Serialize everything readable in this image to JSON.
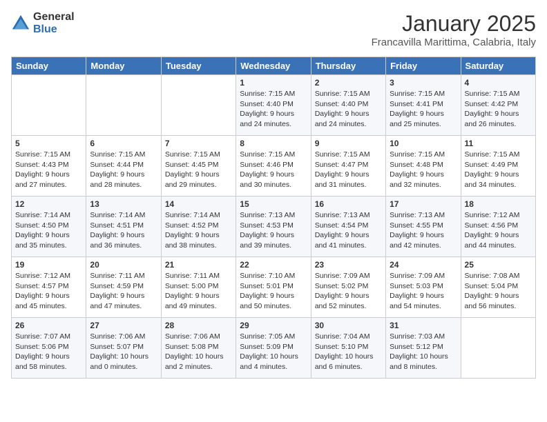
{
  "logo": {
    "general": "General",
    "blue": "Blue"
  },
  "title": "January 2025",
  "subtitle": "Francavilla Marittima, Calabria, Italy",
  "days_of_week": [
    "Sunday",
    "Monday",
    "Tuesday",
    "Wednesday",
    "Thursday",
    "Friday",
    "Saturday"
  ],
  "weeks": [
    [
      {
        "day": "",
        "info": ""
      },
      {
        "day": "",
        "info": ""
      },
      {
        "day": "",
        "info": ""
      },
      {
        "day": "1",
        "info": "Sunrise: 7:15 AM\nSunset: 4:40 PM\nDaylight: 9 hours\nand 24 minutes."
      },
      {
        "day": "2",
        "info": "Sunrise: 7:15 AM\nSunset: 4:40 PM\nDaylight: 9 hours\nand 24 minutes."
      },
      {
        "day": "3",
        "info": "Sunrise: 7:15 AM\nSunset: 4:41 PM\nDaylight: 9 hours\nand 25 minutes."
      },
      {
        "day": "4",
        "info": "Sunrise: 7:15 AM\nSunset: 4:42 PM\nDaylight: 9 hours\nand 26 minutes."
      }
    ],
    [
      {
        "day": "5",
        "info": "Sunrise: 7:15 AM\nSunset: 4:43 PM\nDaylight: 9 hours\nand 27 minutes."
      },
      {
        "day": "6",
        "info": "Sunrise: 7:15 AM\nSunset: 4:44 PM\nDaylight: 9 hours\nand 28 minutes."
      },
      {
        "day": "7",
        "info": "Sunrise: 7:15 AM\nSunset: 4:45 PM\nDaylight: 9 hours\nand 29 minutes."
      },
      {
        "day": "8",
        "info": "Sunrise: 7:15 AM\nSunset: 4:46 PM\nDaylight: 9 hours\nand 30 minutes."
      },
      {
        "day": "9",
        "info": "Sunrise: 7:15 AM\nSunset: 4:47 PM\nDaylight: 9 hours\nand 31 minutes."
      },
      {
        "day": "10",
        "info": "Sunrise: 7:15 AM\nSunset: 4:48 PM\nDaylight: 9 hours\nand 32 minutes."
      },
      {
        "day": "11",
        "info": "Sunrise: 7:15 AM\nSunset: 4:49 PM\nDaylight: 9 hours\nand 34 minutes."
      }
    ],
    [
      {
        "day": "12",
        "info": "Sunrise: 7:14 AM\nSunset: 4:50 PM\nDaylight: 9 hours\nand 35 minutes."
      },
      {
        "day": "13",
        "info": "Sunrise: 7:14 AM\nSunset: 4:51 PM\nDaylight: 9 hours\nand 36 minutes."
      },
      {
        "day": "14",
        "info": "Sunrise: 7:14 AM\nSunset: 4:52 PM\nDaylight: 9 hours\nand 38 minutes."
      },
      {
        "day": "15",
        "info": "Sunrise: 7:13 AM\nSunset: 4:53 PM\nDaylight: 9 hours\nand 39 minutes."
      },
      {
        "day": "16",
        "info": "Sunrise: 7:13 AM\nSunset: 4:54 PM\nDaylight: 9 hours\nand 41 minutes."
      },
      {
        "day": "17",
        "info": "Sunrise: 7:13 AM\nSunset: 4:55 PM\nDaylight: 9 hours\nand 42 minutes."
      },
      {
        "day": "18",
        "info": "Sunrise: 7:12 AM\nSunset: 4:56 PM\nDaylight: 9 hours\nand 44 minutes."
      }
    ],
    [
      {
        "day": "19",
        "info": "Sunrise: 7:12 AM\nSunset: 4:57 PM\nDaylight: 9 hours\nand 45 minutes."
      },
      {
        "day": "20",
        "info": "Sunrise: 7:11 AM\nSunset: 4:59 PM\nDaylight: 9 hours\nand 47 minutes."
      },
      {
        "day": "21",
        "info": "Sunrise: 7:11 AM\nSunset: 5:00 PM\nDaylight: 9 hours\nand 49 minutes."
      },
      {
        "day": "22",
        "info": "Sunrise: 7:10 AM\nSunset: 5:01 PM\nDaylight: 9 hours\nand 50 minutes."
      },
      {
        "day": "23",
        "info": "Sunrise: 7:09 AM\nSunset: 5:02 PM\nDaylight: 9 hours\nand 52 minutes."
      },
      {
        "day": "24",
        "info": "Sunrise: 7:09 AM\nSunset: 5:03 PM\nDaylight: 9 hours\nand 54 minutes."
      },
      {
        "day": "25",
        "info": "Sunrise: 7:08 AM\nSunset: 5:04 PM\nDaylight: 9 hours\nand 56 minutes."
      }
    ],
    [
      {
        "day": "26",
        "info": "Sunrise: 7:07 AM\nSunset: 5:06 PM\nDaylight: 9 hours\nand 58 minutes."
      },
      {
        "day": "27",
        "info": "Sunrise: 7:06 AM\nSunset: 5:07 PM\nDaylight: 10 hours\nand 0 minutes."
      },
      {
        "day": "28",
        "info": "Sunrise: 7:06 AM\nSunset: 5:08 PM\nDaylight: 10 hours\nand 2 minutes."
      },
      {
        "day": "29",
        "info": "Sunrise: 7:05 AM\nSunset: 5:09 PM\nDaylight: 10 hours\nand 4 minutes."
      },
      {
        "day": "30",
        "info": "Sunrise: 7:04 AM\nSunset: 5:10 PM\nDaylight: 10 hours\nand 6 minutes."
      },
      {
        "day": "31",
        "info": "Sunrise: 7:03 AM\nSunset: 5:12 PM\nDaylight: 10 hours\nand 8 minutes."
      },
      {
        "day": "",
        "info": ""
      }
    ]
  ]
}
